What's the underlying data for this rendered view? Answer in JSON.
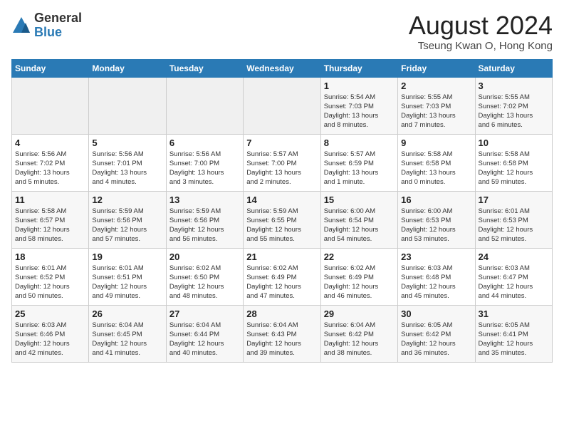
{
  "logo": {
    "general": "General",
    "blue": "Blue"
  },
  "title": "August 2024",
  "location": "Tseung Kwan O, Hong Kong",
  "days_of_week": [
    "Sunday",
    "Monday",
    "Tuesday",
    "Wednesday",
    "Thursday",
    "Friday",
    "Saturday"
  ],
  "weeks": [
    [
      {
        "day": "",
        "info": ""
      },
      {
        "day": "",
        "info": ""
      },
      {
        "day": "",
        "info": ""
      },
      {
        "day": "",
        "info": ""
      },
      {
        "day": "1",
        "info": "Sunrise: 5:54 AM\nSunset: 7:03 PM\nDaylight: 13 hours\nand 8 minutes."
      },
      {
        "day": "2",
        "info": "Sunrise: 5:55 AM\nSunset: 7:03 PM\nDaylight: 13 hours\nand 7 minutes."
      },
      {
        "day": "3",
        "info": "Sunrise: 5:55 AM\nSunset: 7:02 PM\nDaylight: 13 hours\nand 6 minutes."
      }
    ],
    [
      {
        "day": "4",
        "info": "Sunrise: 5:56 AM\nSunset: 7:02 PM\nDaylight: 13 hours\nand 5 minutes."
      },
      {
        "day": "5",
        "info": "Sunrise: 5:56 AM\nSunset: 7:01 PM\nDaylight: 13 hours\nand 4 minutes."
      },
      {
        "day": "6",
        "info": "Sunrise: 5:56 AM\nSunset: 7:00 PM\nDaylight: 13 hours\nand 3 minutes."
      },
      {
        "day": "7",
        "info": "Sunrise: 5:57 AM\nSunset: 7:00 PM\nDaylight: 13 hours\nand 2 minutes."
      },
      {
        "day": "8",
        "info": "Sunrise: 5:57 AM\nSunset: 6:59 PM\nDaylight: 13 hours\nand 1 minute."
      },
      {
        "day": "9",
        "info": "Sunrise: 5:58 AM\nSunset: 6:58 PM\nDaylight: 13 hours\nand 0 minutes."
      },
      {
        "day": "10",
        "info": "Sunrise: 5:58 AM\nSunset: 6:58 PM\nDaylight: 12 hours\nand 59 minutes."
      }
    ],
    [
      {
        "day": "11",
        "info": "Sunrise: 5:58 AM\nSunset: 6:57 PM\nDaylight: 12 hours\nand 58 minutes."
      },
      {
        "day": "12",
        "info": "Sunrise: 5:59 AM\nSunset: 6:56 PM\nDaylight: 12 hours\nand 57 minutes."
      },
      {
        "day": "13",
        "info": "Sunrise: 5:59 AM\nSunset: 6:56 PM\nDaylight: 12 hours\nand 56 minutes."
      },
      {
        "day": "14",
        "info": "Sunrise: 5:59 AM\nSunset: 6:55 PM\nDaylight: 12 hours\nand 55 minutes."
      },
      {
        "day": "15",
        "info": "Sunrise: 6:00 AM\nSunset: 6:54 PM\nDaylight: 12 hours\nand 54 minutes."
      },
      {
        "day": "16",
        "info": "Sunrise: 6:00 AM\nSunset: 6:53 PM\nDaylight: 12 hours\nand 53 minutes."
      },
      {
        "day": "17",
        "info": "Sunrise: 6:01 AM\nSunset: 6:53 PM\nDaylight: 12 hours\nand 52 minutes."
      }
    ],
    [
      {
        "day": "18",
        "info": "Sunrise: 6:01 AM\nSunset: 6:52 PM\nDaylight: 12 hours\nand 50 minutes."
      },
      {
        "day": "19",
        "info": "Sunrise: 6:01 AM\nSunset: 6:51 PM\nDaylight: 12 hours\nand 49 minutes."
      },
      {
        "day": "20",
        "info": "Sunrise: 6:02 AM\nSunset: 6:50 PM\nDaylight: 12 hours\nand 48 minutes."
      },
      {
        "day": "21",
        "info": "Sunrise: 6:02 AM\nSunset: 6:49 PM\nDaylight: 12 hours\nand 47 minutes."
      },
      {
        "day": "22",
        "info": "Sunrise: 6:02 AM\nSunset: 6:49 PM\nDaylight: 12 hours\nand 46 minutes."
      },
      {
        "day": "23",
        "info": "Sunrise: 6:03 AM\nSunset: 6:48 PM\nDaylight: 12 hours\nand 45 minutes."
      },
      {
        "day": "24",
        "info": "Sunrise: 6:03 AM\nSunset: 6:47 PM\nDaylight: 12 hours\nand 44 minutes."
      }
    ],
    [
      {
        "day": "25",
        "info": "Sunrise: 6:03 AM\nSunset: 6:46 PM\nDaylight: 12 hours\nand 42 minutes."
      },
      {
        "day": "26",
        "info": "Sunrise: 6:04 AM\nSunset: 6:45 PM\nDaylight: 12 hours\nand 41 minutes."
      },
      {
        "day": "27",
        "info": "Sunrise: 6:04 AM\nSunset: 6:44 PM\nDaylight: 12 hours\nand 40 minutes."
      },
      {
        "day": "28",
        "info": "Sunrise: 6:04 AM\nSunset: 6:43 PM\nDaylight: 12 hours\nand 39 minutes."
      },
      {
        "day": "29",
        "info": "Sunrise: 6:04 AM\nSunset: 6:42 PM\nDaylight: 12 hours\nand 38 minutes."
      },
      {
        "day": "30",
        "info": "Sunrise: 6:05 AM\nSunset: 6:42 PM\nDaylight: 12 hours\nand 36 minutes."
      },
      {
        "day": "31",
        "info": "Sunrise: 6:05 AM\nSunset: 6:41 PM\nDaylight: 12 hours\nand 35 minutes."
      }
    ]
  ]
}
